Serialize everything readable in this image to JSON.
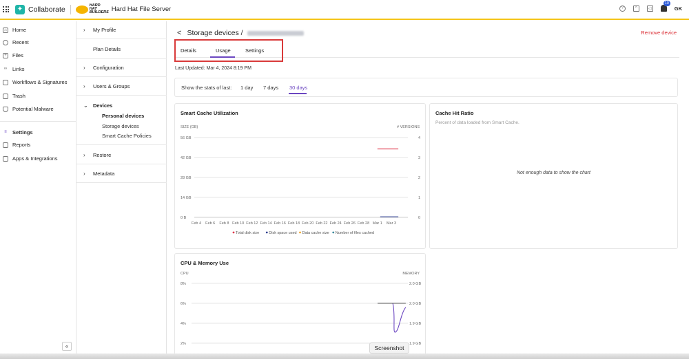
{
  "topbar": {
    "app_name": "Collaborate",
    "brand_text": "HARD HAT BUILDERS",
    "server_name": "Hard Hat File Server",
    "notification_count": "10",
    "user_initials": "GK"
  },
  "leftnav": {
    "items": [
      {
        "label": "Home",
        "icon": "home-icon"
      },
      {
        "label": "Recent",
        "icon": "clock-icon"
      },
      {
        "label": "Files",
        "icon": "file-icon"
      },
      {
        "label": "Links",
        "icon": "link-icon"
      },
      {
        "label": "Workflows & Signatures",
        "icon": "workflow-icon"
      },
      {
        "label": "Trash",
        "icon": "trash-icon"
      },
      {
        "label": "Potential Malware",
        "icon": "shield-icon"
      },
      {
        "label": "Settings",
        "icon": "settings-icon"
      },
      {
        "label": "Reports",
        "icon": "report-icon"
      },
      {
        "label": "Apps & Integrations",
        "icon": "apps-icon"
      }
    ],
    "collapse_glyph": "«"
  },
  "settings_nav": {
    "my_profile": "My Profile",
    "plan_details": "Plan Details",
    "configuration": "Configuration",
    "users_groups": "Users & Groups",
    "devices": "Devices",
    "personal_devices": "Personal devices",
    "storage_devices": "Storage devices",
    "smart_cache_policies": "Smart Cache Policies",
    "restore": "Restore",
    "metadata": "Metadata"
  },
  "main": {
    "back_glyph": "<",
    "title": "Storage devices /",
    "remove_label": "Remove device",
    "tabs": [
      {
        "label": "Details"
      },
      {
        "label": "Usage"
      },
      {
        "label": "Settings"
      }
    ],
    "last_updated": "Last Updated: Mar 4, 2024 8:19 PM",
    "stats_label": "Show the stats of last:",
    "stats_options": [
      "1 day",
      "7 days",
      "30 days"
    ],
    "active_stats_option": "30 days"
  },
  "cache_hit": {
    "title": "Cache Hit Ratio",
    "subtitle": "Percent of data loaded from Smart Cache.",
    "empty_text": "Not enough data to show the chart"
  },
  "screenshot_label": "Screenshot",
  "colors": {
    "accent": "#6b46c1",
    "danger": "#d9282f",
    "highlight_border": "#d93a3a",
    "topbar_rule": "#f5c518",
    "brand": "#1fb5a8"
  },
  "chart_data": [
    {
      "type": "line",
      "title": "Smart Cache Utilization",
      "ylabel": "SIZE (GB)",
      "y2label": "# VERSIONS",
      "categories": [
        "Feb 4",
        "Feb 6",
        "Feb 8",
        "Feb 10",
        "Feb 12",
        "Feb 14",
        "Feb 16",
        "Feb 18",
        "Feb 20",
        "Feb 22",
        "Feb 24",
        "Feb 26",
        "Feb 28",
        "Mar 1",
        "Mar 3"
      ],
      "y_ticks": [
        "0 B",
        "14 GB",
        "28 GB",
        "42 GB",
        "56 GB"
      ],
      "y2_ticks": [
        "0",
        "1",
        "2",
        "3",
        "4"
      ],
      "ylim": [
        0,
        56
      ],
      "y2lim": [
        0,
        4
      ],
      "series": [
        {
          "name": "Total disk size",
          "color": "#e0384b",
          "points": [
            [
              13.0,
              48
            ],
            [
              14.5,
              48
            ]
          ]
        },
        {
          "name": "Disk space used",
          "color": "#2f3f8f",
          "points": [
            [
              13.2,
              0.3
            ],
            [
              14.5,
              0.3
            ]
          ]
        },
        {
          "name": "Data cache size",
          "color": "#f0a830",
          "points": []
        },
        {
          "name": "Number of files cached",
          "color": "#3d8a9e",
          "points": []
        }
      ],
      "grid": true,
      "legend": "bottom"
    },
    {
      "type": "line",
      "title": "CPU & Memory Use",
      "ylabel": "CPU",
      "y2label": "MEMORY",
      "y_ticks": [
        "2%",
        "4%",
        "6%",
        "8%"
      ],
      "y2_ticks": [
        "1.9 GB",
        "1.9 GB",
        "2.0 GB",
        "2.0 GB"
      ],
      "ylim": [
        2,
        8
      ],
      "series": [
        {
          "name": "CPU",
          "color": "#6b46c1",
          "points": [
            [
              0.86,
              6
            ],
            [
              0.93,
              6
            ],
            [
              0.94,
              3.1
            ],
            [
              0.99,
              5.6
            ]
          ]
        },
        {
          "name": "Memory",
          "color": "#555555",
          "points": [
            [
              0.86,
              6
            ],
            [
              0.99,
              6
            ]
          ]
        }
      ],
      "grid": true
    }
  ]
}
